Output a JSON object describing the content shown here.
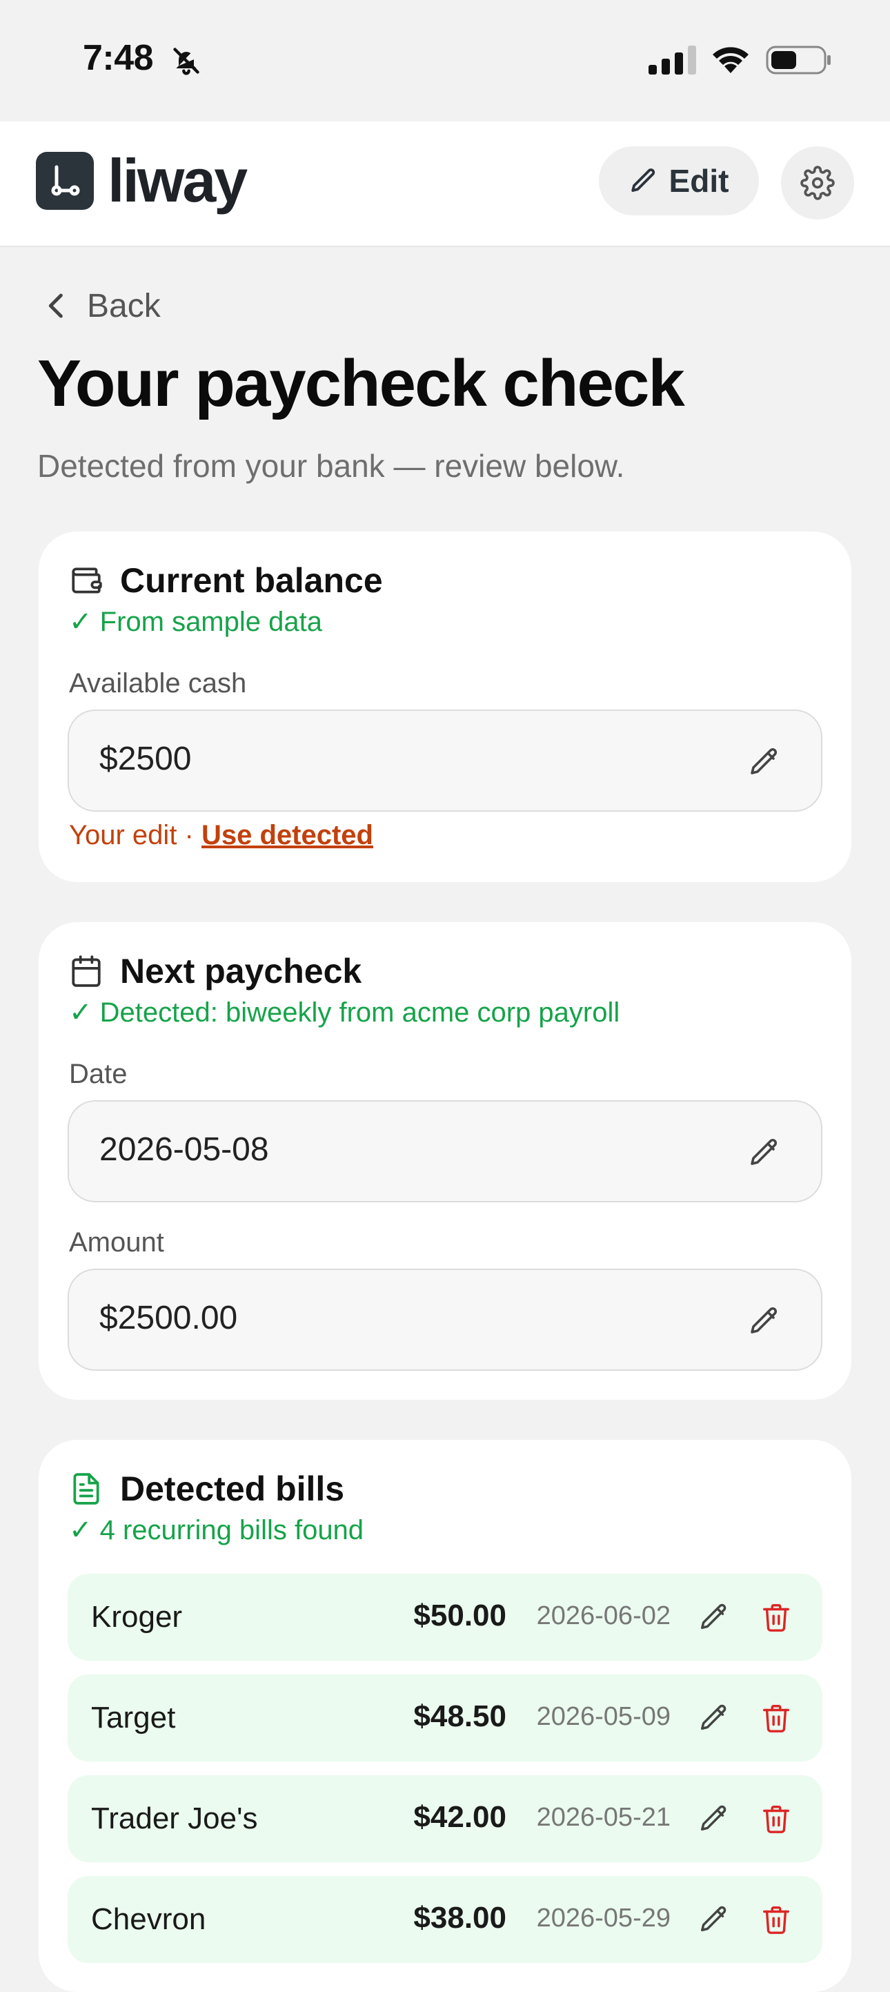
{
  "status_bar": {
    "time": "7:48"
  },
  "header": {
    "brand": "liway",
    "edit_label": "Edit"
  },
  "nav": {
    "back_label": "Back"
  },
  "page": {
    "title": "Your paycheck check",
    "subtitle": "Detected from your bank — review below."
  },
  "balance_card": {
    "title": "Current balance",
    "status": "✓ From sample data",
    "field_label": "Available cash",
    "field_value": "$2500",
    "edit_note_prefix": "Your edit · ",
    "use_detected_label": "Use detected"
  },
  "paycheck_card": {
    "title": "Next paycheck",
    "status": "✓ Detected: biweekly from acme corp payroll",
    "date_label": "Date",
    "date_value": "2026-05-08",
    "amount_label": "Amount",
    "amount_value": "$2500.00"
  },
  "bills_card": {
    "title": "Detected bills",
    "status": "✓ 4 recurring bills found",
    "bills": [
      {
        "name": "Kroger",
        "amount": "$50.00",
        "date": "2026-06-02"
      },
      {
        "name": "Target",
        "amount": "$48.50",
        "date": "2026-05-09"
      },
      {
        "name": "Trader Joe's",
        "amount": "$42.00",
        "date": "2026-05-21"
      },
      {
        "name": "Chevron",
        "amount": "$38.00",
        "date": "2026-05-29"
      }
    ]
  },
  "colors": {
    "success": "#16a34a",
    "warning": "#c2410c",
    "danger": "#dc2626",
    "bill_row_bg": "#ebfbef",
    "brand_dark": "#2b333b"
  },
  "icons": {
    "status_bar": [
      "bell-off-icon",
      "signal-icon",
      "wifi-icon",
      "battery-icon"
    ],
    "header": [
      "logo-icon",
      "pencil-icon",
      "gear-icon"
    ],
    "cards": [
      "wallet-icon",
      "calendar-icon",
      "document-icon"
    ],
    "bill_row": [
      "pencil-icon",
      "trash-icon"
    ]
  }
}
